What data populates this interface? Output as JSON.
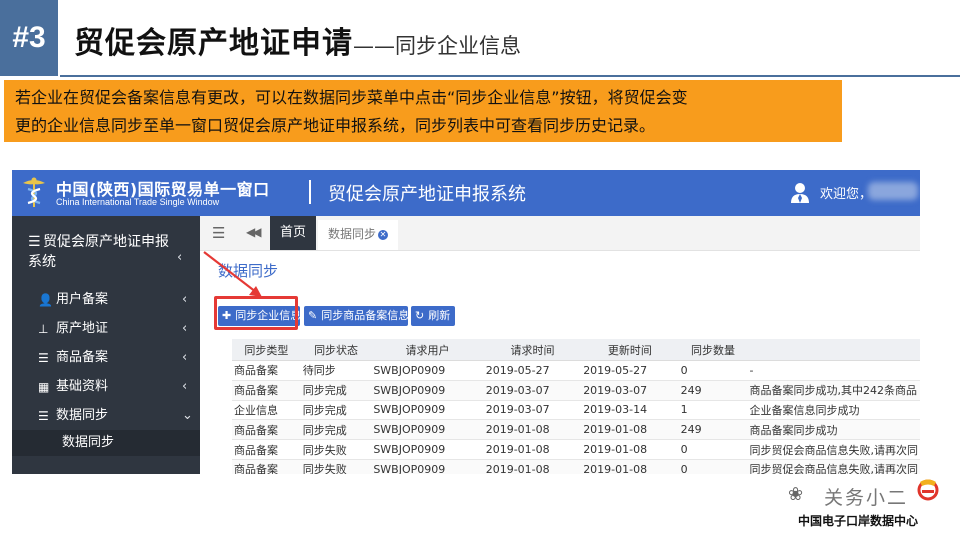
{
  "slide": {
    "number": "#3",
    "title": "贸促会原产地证申请",
    "subtitle": "——同步企业信息",
    "notice_line1": "若企业在贸促会备案信息有更改，可以在数据同步菜单中点击“同步企业信息”按钮，将贸促会变",
    "notice_line2": "更的企业信息同步至单一窗口贸促会原产地证申报系统，同步列表中可查看同步历史记录。",
    "colors": {
      "accent": "#4a6f9c",
      "notice_bg": "#f89c1c"
    }
  },
  "app": {
    "brand_cn": "中国(陕西)国际贸易单一窗口",
    "brand_en": "China International Trade Single Window",
    "system_title": "贸促会原产地证申报系统",
    "welcome": "欢迎您，",
    "colors": {
      "topbar": "#3d6bc9",
      "sidebar": "#2f3640",
      "highlight": "#e53935"
    },
    "sidebar": {
      "header": "贸促会原产地证申报系统",
      "items": [
        {
          "label": "用户备案",
          "icon": "user-icon"
        },
        {
          "label": "原产地证",
          "icon": "stamp-icon"
        },
        {
          "label": "商品备案",
          "icon": "list-icon"
        },
        {
          "label": "基础资料",
          "icon": "grid-icon"
        },
        {
          "label": "数据同步",
          "icon": "list-icon",
          "expanded": true
        }
      ],
      "sub_item": "数据同步"
    },
    "tabs": {
      "home": "首页",
      "active": "数据同步"
    },
    "section_title": "数据同步",
    "buttons": {
      "sync_enterprise": "同步企业信息",
      "sync_goods": "同步商品备案信息",
      "refresh": "刷新"
    },
    "table": {
      "columns": [
        "同步类型",
        "同步状态",
        "请求用户",
        "请求时间",
        "更新时间",
        "同步数量",
        ""
      ],
      "rows": [
        [
          "商品备案",
          "待同步",
          "SWBJOP0909",
          "2019-05-27",
          "2019-05-27",
          "0",
          "-"
        ],
        [
          "商品备案",
          "同步完成",
          "SWBJOP0909",
          "2019-03-07",
          "2019-03-07",
          "249",
          "商品备案同步成功,其中242条商品"
        ],
        [
          "企业信息",
          "同步完成",
          "SWBJOP0909",
          "2019-03-07",
          "2019-03-14",
          "1",
          "企业备案信息同步成功"
        ],
        [
          "商品备案",
          "同步完成",
          "SWBJOP0909",
          "2019-01-08",
          "2019-01-08",
          "249",
          "商品备案同步成功"
        ],
        [
          "商品备案",
          "同步失败",
          "SWBJOP0909",
          "2019-01-08",
          "2019-01-08",
          "0",
          "同步贸促会商品信息失败,请再次同"
        ],
        [
          "商品备案",
          "同步失败",
          "SWBJOP0909",
          "2019-01-08",
          "2019-01-08",
          "0",
          "同步贸促会商品信息失败,请再次同"
        ]
      ]
    }
  },
  "watermark": {
    "name": "关务小二",
    "org": "中国电子口岸数据中心"
  }
}
